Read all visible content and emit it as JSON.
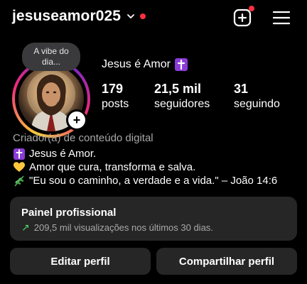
{
  "header": {
    "username": "jesuseamor025",
    "icons": {
      "account_switch": "chevron-down-icon",
      "new_post": "plus-square-icon",
      "menu": "hamburger-menu-icon"
    },
    "notification_color": "#ff3040"
  },
  "profile": {
    "note": "A vibe do dia...",
    "display_name": "Jesus é Amor",
    "display_name_emoji": "latin-cross-icon",
    "stats": [
      {
        "value": "179",
        "label": "posts"
      },
      {
        "value": "21,5 mil",
        "label": "seguidores"
      },
      {
        "value": "31",
        "label": "seguindo"
      }
    ],
    "category": "Criador(a) de conteúdo digital",
    "bio": [
      {
        "icon": "latin-cross-icon",
        "text": "Jesus é Amor."
      },
      {
        "icon": "yellow-heart-icon",
        "text": "Amor que cura, transforma e salva."
      },
      {
        "icon": "herb-icon",
        "text": "\"Eu sou o caminho, a verdade e a vida.\" – João 14:6"
      }
    ]
  },
  "professional_panel": {
    "title": "Painel profissional",
    "subtitle": "209,5 mil visualizações nos últimos 30 dias."
  },
  "actions": {
    "edit_label": "Editar perfil",
    "share_label": "Compartilhar perfil"
  }
}
